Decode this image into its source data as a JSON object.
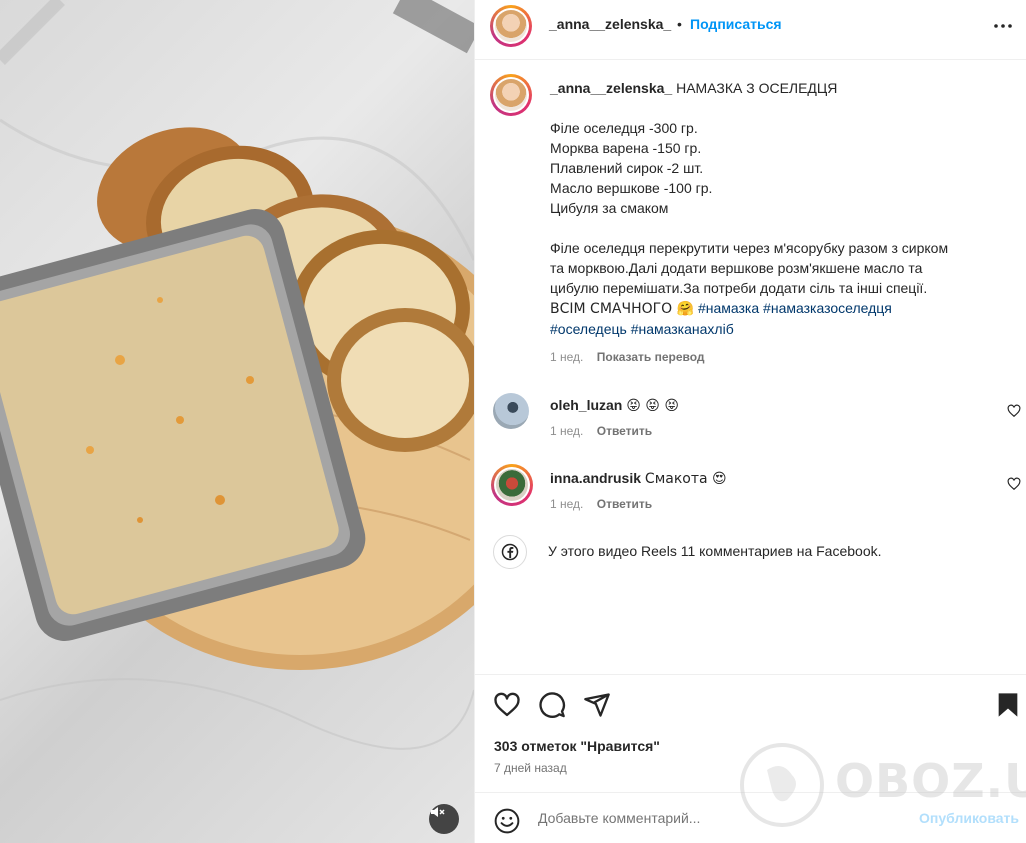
{
  "post": {
    "username": "_anna__zelenska_",
    "follow_label": "Подписаться",
    "separator": "•"
  },
  "caption": {
    "username": "_anna__zelenska_",
    "title": "НАМАЗКА З ОСЕЛЕДЦЯ",
    "ingredients": [
      "Філе оселедця -300 гр.",
      "Морква варена -150 гр.",
      "Плавлений сирок -2 шт.",
      "Масло вершкове -100 гр.",
      "Цибуля за смаком"
    ],
    "body_lines": [
      "Філе оселедця перекрутити через м'ясорубку разом з сирком",
      "та морквою.Далі додати вершкове розм'якшене масло та",
      "цибулю перемішати.За потреби додати сіль та інші спеції."
    ],
    "closing": "ВСІМ СМАЧНОГО 🤗",
    "hashtags_line1": [
      "#намазка",
      "#намазказоселедця"
    ],
    "hashtags_line2": [
      "#оселедець",
      "#намазканахліб"
    ],
    "age": "1 нед.",
    "translate_label": "Показать перевод"
  },
  "comments": [
    {
      "username": "oleh_luzan",
      "text": "😝 😝 😝",
      "age": "1 нед.",
      "reply_label": "Ответить"
    },
    {
      "username": "inna.andrusik",
      "text": "Смакота 😍",
      "age": "1 нед.",
      "reply_label": "Ответить"
    }
  ],
  "facebook_note": "У этого видео Reels 11 комментариев на Facebook.",
  "likes_text": "303 отметок \"Нравится\"",
  "posted_date": "7 дней назад",
  "add_comment": {
    "placeholder": "Добавьте комментарий...",
    "publish_label": "Опубликовать"
  },
  "watermark_text": "OBOZ.UA",
  "colors": {
    "link_blue": "#0095f6",
    "hashtag": "#00376b",
    "muted": "#8e8e8e",
    "publish_disabled": "#b2dffc"
  },
  "icons": [
    "more-icon",
    "heart-icon",
    "comment-icon",
    "share-icon",
    "bookmark-icon",
    "emoji-icon",
    "facebook-icon",
    "mute-icon"
  ]
}
